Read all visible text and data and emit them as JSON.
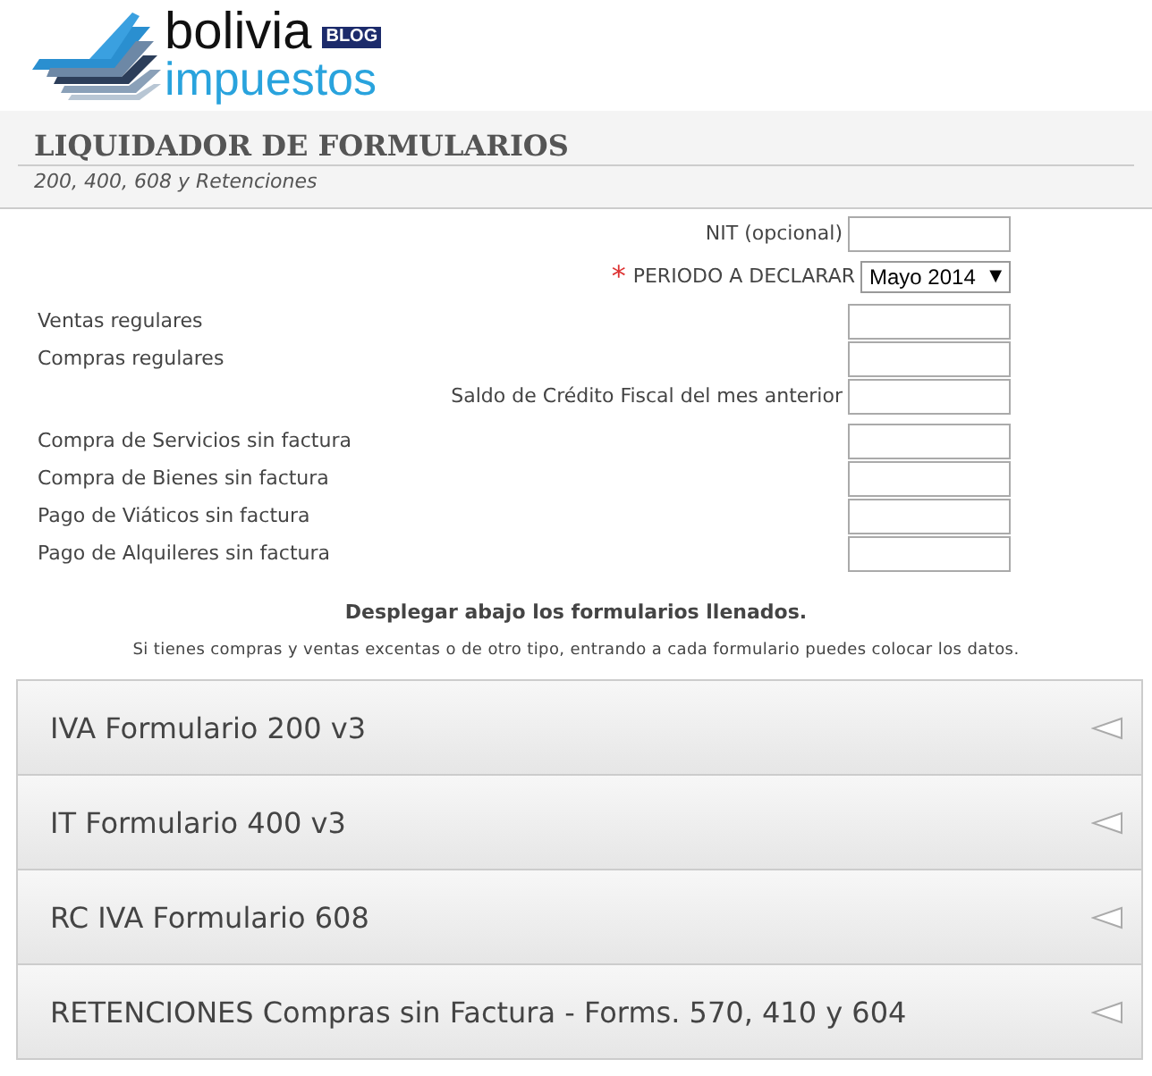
{
  "logo": {
    "word_top": "bolivia",
    "badge": "BLOG",
    "word_bottom": "impuestos"
  },
  "header": {
    "title": "LIQUIDADOR DE FORMULARIOS",
    "subtitle": "200, 400, 608 y Retenciones"
  },
  "fields": [
    {
      "kind": "inline_input",
      "label": "NIT (opcional)",
      "required": false
    },
    {
      "kind": "inline_select",
      "label": "PERIODO A DECLARAR",
      "required": true,
      "required_mark": "*",
      "value": "Mayo 2014",
      "caret": "▼"
    },
    {
      "kind": "input",
      "label": "Ventas regulares",
      "required": false
    },
    {
      "kind": "input",
      "label": "Compras regulares",
      "required": false
    },
    {
      "kind": "inline_input",
      "label": "Saldo de Crédito Fiscal del mes anterior",
      "required": false
    },
    {
      "kind": "input",
      "label": "Compra de Servicios sin factura",
      "required": false
    },
    {
      "kind": "input",
      "label": "Compra de Bienes sin factura",
      "required": false
    },
    {
      "kind": "input",
      "label": "Pago de Viáticos sin factura",
      "required": false
    },
    {
      "kind": "input",
      "label": "Pago de Alquileres sin factura",
      "required": false
    }
  ],
  "instructions": {
    "heading": "Desplegar abajo los formularios llenados.",
    "note": "Si tienes compras y ventas excentas o de otro tipo, entrando a cada formulario puedes colocar los datos."
  },
  "sections": [
    {
      "title": "IVA Formulario 200 v3",
      "expanded": false
    },
    {
      "title": "IT Formulario 400 v3",
      "expanded": false
    },
    {
      "title": "RC IVA Formulario 608",
      "expanded": false
    },
    {
      "title": "RETENCIONES Compras sin Factura - Forms. 570, 410 y 604",
      "expanded": false
    }
  ]
}
